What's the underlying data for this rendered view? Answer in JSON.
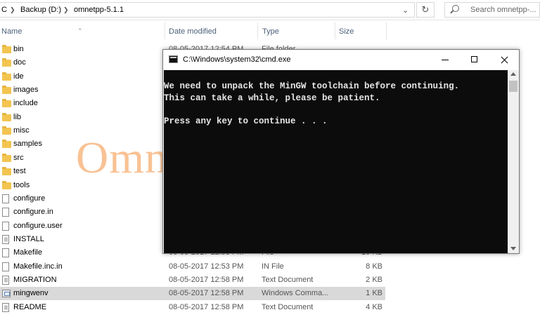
{
  "explorer": {
    "breadcrumb": [
      "C",
      "Backup (D:)",
      "omnetpp-5.1.1"
    ],
    "search_placeholder": "Search omnetpp-...",
    "columns": {
      "name": "Name",
      "date": "Date modified",
      "type": "Type",
      "size": "Size"
    },
    "files": [
      {
        "name": "bin",
        "icon": "folder",
        "date": "08-05-2017 12:54 PM",
        "type": "File folder",
        "size": ""
      },
      {
        "name": "doc",
        "icon": "folder",
        "date": "",
        "type": "",
        "size": ""
      },
      {
        "name": "ide",
        "icon": "folder",
        "date": "",
        "type": "",
        "size": ""
      },
      {
        "name": "images",
        "icon": "folder",
        "date": "",
        "type": "",
        "size": ""
      },
      {
        "name": "include",
        "icon": "folder",
        "date": "",
        "type": "",
        "size": ""
      },
      {
        "name": "lib",
        "icon": "folder",
        "date": "",
        "type": "",
        "size": ""
      },
      {
        "name": "misc",
        "icon": "folder",
        "date": "",
        "type": "",
        "size": ""
      },
      {
        "name": "samples",
        "icon": "folder",
        "date": "",
        "type": "",
        "size": ""
      },
      {
        "name": "src",
        "icon": "folder",
        "date": "",
        "type": "",
        "size": ""
      },
      {
        "name": "test",
        "icon": "folder",
        "date": "",
        "type": "",
        "size": ""
      },
      {
        "name": "tools",
        "icon": "folder",
        "date": "",
        "type": "",
        "size": ""
      },
      {
        "name": "configure",
        "icon": "file",
        "date": "",
        "type": "",
        "size": ""
      },
      {
        "name": "configure.in",
        "icon": "file",
        "date": "",
        "type": "",
        "size": ""
      },
      {
        "name": "configure.user",
        "icon": "file",
        "date": "",
        "type": "",
        "size": ""
      },
      {
        "name": "INSTALL",
        "icon": "text",
        "date": "",
        "type": "",
        "size": ""
      },
      {
        "name": "Makefile",
        "icon": "file",
        "date": "08-05-2017 12:53 PM",
        "type": "File",
        "size": "10 KB"
      },
      {
        "name": "Makefile.inc.in",
        "icon": "file",
        "date": "08-05-2017 12:53 PM",
        "type": "IN File",
        "size": "8 KB"
      },
      {
        "name": "MIGRATION",
        "icon": "text",
        "date": "08-05-2017 12:58 PM",
        "type": "Text Document",
        "size": "2 KB"
      },
      {
        "name": "mingwenv",
        "icon": "bat",
        "date": "08-05-2017 12:58 PM",
        "type": "Windows Comma...",
        "size": "1 KB",
        "selected": true
      },
      {
        "name": "README",
        "icon": "text",
        "date": "08-05-2017 12:58 PM",
        "type": "Text Document",
        "size": "4 KB"
      }
    ]
  },
  "cmd": {
    "title": "C:\\Windows\\system32\\cmd.exe",
    "lines": [
      "We need to unpack the MinGW toolchain before continuing.",
      "This can take a while, please be patient.",
      "",
      "Press any key to continue . . ."
    ]
  },
  "watermark": "Omnetplusplus.com",
  "colors": {
    "terminal_bg": "#0c0c0c",
    "terminal_fg": "#e6e6e6",
    "selection": "#d9d9d9",
    "folder": "#f3c550",
    "watermark": "#f49646"
  }
}
